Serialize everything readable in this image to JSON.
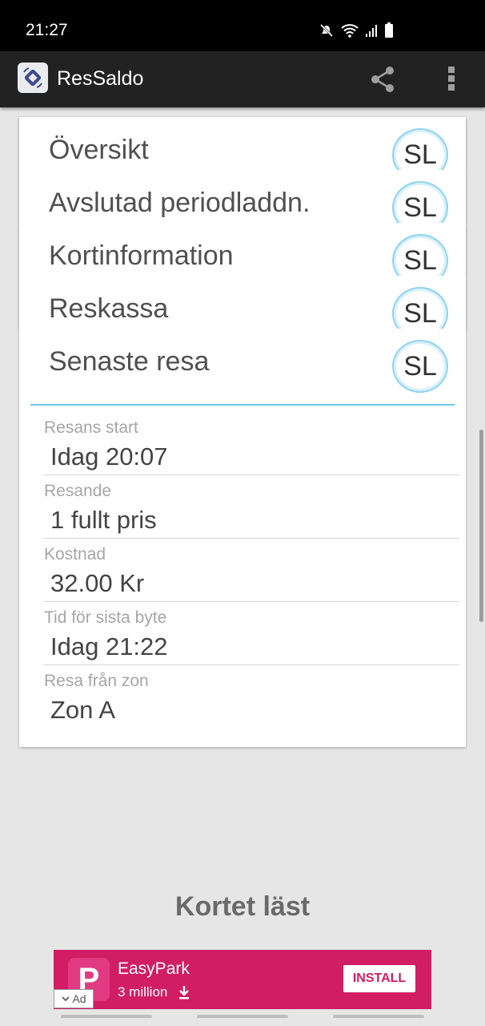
{
  "status_bar": {
    "time": "21:27"
  },
  "app_bar": {
    "title": "ResSaldo",
    "share_icon": "share-icon",
    "menu_icon": "more-vert-icon"
  },
  "menu": {
    "badge": "SL",
    "items": [
      {
        "label": "Översikt"
      },
      {
        "label": "Avslutad periodladdn."
      },
      {
        "label": "Kortinformation"
      },
      {
        "label": "Reskassa"
      }
    ],
    "expanded": {
      "label": "Senaste resa"
    }
  },
  "details": [
    {
      "label": "Resans start",
      "value": "Idag 20:07"
    },
    {
      "label": "Resande",
      "value": "1 fullt pris"
    },
    {
      "label": "Kostnad",
      "value": "32.00 Kr"
    },
    {
      "label": "Tid för sista byte",
      "value": "Idag 21:22"
    },
    {
      "label": "Resa från zon",
      "value": "Zon A"
    }
  ],
  "status_message": "Kortet läst",
  "ad": {
    "app_name": "EasyPark",
    "downloads": "3 million",
    "install_label": "INSTALL",
    "badge": "Ad",
    "color": "#d01d63"
  }
}
